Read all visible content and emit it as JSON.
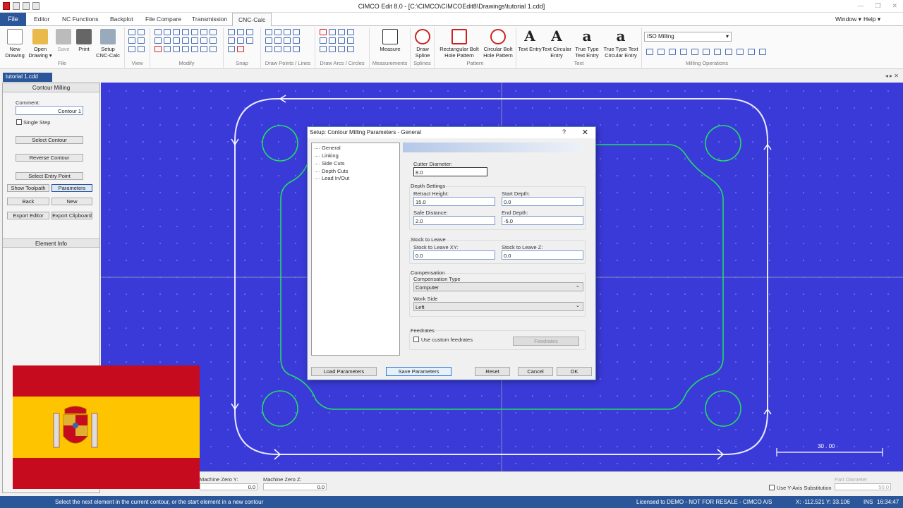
{
  "window": {
    "title": "CIMCO Edit 8.0 - [C:\\CIMCO\\CIMCOEdit8\\Drawings\\tutorial 1.cdd]"
  },
  "menu_tabs": [
    "File",
    "Editor",
    "NC Functions",
    "Backplot",
    "File Compare",
    "Transmission",
    "CNC-Calc"
  ],
  "menu_right": {
    "window": "Window ▾",
    "help": "Help ▾"
  },
  "ribbon": {
    "file_group": {
      "label": "File",
      "new": "New Drawing",
      "open": "Open Drawing ▾",
      "save": "Save",
      "print": "Print",
      "setup": "Setup CNC-Calc"
    },
    "view_label": "View",
    "modify_label": "Modify",
    "snap_label": "Snap",
    "points_label": "Draw Points / Lines",
    "arcs_label": "Draw Arcs / Circles",
    "measure": {
      "button": "Measure",
      "label": "Measurements"
    },
    "splines": {
      "button": "Draw Spline",
      "label": "Splines"
    },
    "pattern": {
      "rect": "Rectangular Bolt Hole Pattern",
      "circ": "Circular Bolt Hole Pattern",
      "label": "Pattern"
    },
    "text": {
      "entry": "Text Entry",
      "circ": "Text Circular Entry",
      "tt": "True Type Text Entry",
      "ttc": "True Type Text Circular Entry",
      "label": "Text"
    },
    "milling": {
      "select": "ISO Milling",
      "label": "Milling Operations"
    }
  },
  "doc_tab": "tutorial 1.cdd",
  "left_panel": {
    "header": "Contour Milling",
    "comment_label": "Comment:",
    "comment_value": "Contour 1",
    "single_step": "Single Step",
    "select_contour": "Select Contour",
    "reverse_contour": "Reverse Contour",
    "select_entry": "Select Entry Point",
    "show_toolpath": "Show Toolpath",
    "parameters": "Parameters",
    "back": "Back",
    "new": "New",
    "export_editor": "Export Editor",
    "export_clipboard": "Export Clipboard",
    "element_info": "Element Info"
  },
  "canvas": {
    "scale_label": "30 . 00"
  },
  "dialog": {
    "title": "Setup: Contour Milling Parameters - General",
    "help": "?",
    "close": "✕",
    "tree": [
      "General",
      "Linking",
      "Side Cuts",
      "Depth Cuts",
      "Lead In/Out"
    ],
    "cutter_diameter_label": "Cutter Diameter:",
    "cutter_diameter": "8.0",
    "depth_settings": "Depth Settings",
    "retract_label": "Retract Height:",
    "retract": "15.0",
    "start_depth_label": "Start Depth:",
    "start_depth": "0.0",
    "safe_label": "Safe Distance:",
    "safe": "2.0",
    "end_depth_label": "End Depth:",
    "end_depth": "-5.0",
    "stock_title": "Stock to Leave",
    "stock_xy_label": "Stock to Leave XY:",
    "stock_xy": "0.0",
    "stock_z_label": "Stock to Leave Z:",
    "stock_z": "0.0",
    "comp_title": "Compensation",
    "comp_type_label": "Compensation Type",
    "comp_type": "Computer",
    "work_side_label": "Work Side",
    "work_side": "Left",
    "feed_title": "Feedrates",
    "use_custom": "Use custom feedrates",
    "feed_btn": "Feedrates",
    "load": "Load Parameters",
    "save": "Save Parameters",
    "reset": "Reset",
    "cancel": "Cancel",
    "ok": "OK"
  },
  "bottom": {
    "mzy_label": "Machine Zero Y:",
    "mzy": "0.0",
    "mzz_label": "Machine Zero Z:",
    "mzz": "0.0",
    "y_axis": "Use Y-Axis Substitution",
    "part_diam_label": "Part Diameter",
    "part_diam": "50.0"
  },
  "status": {
    "message": "Select the next element in the current contour, or the start element in a new contour",
    "license": "Licensed to DEMO - NOT FOR RESALE - CIMCO A/S",
    "coords": "X: -112.521 Y: 33.106",
    "ins": "INS",
    "time": "16:34:47"
  },
  "colors": {
    "canvas": "#3a3ad8",
    "contour": "#22dd66",
    "accent": "#2b579a"
  }
}
